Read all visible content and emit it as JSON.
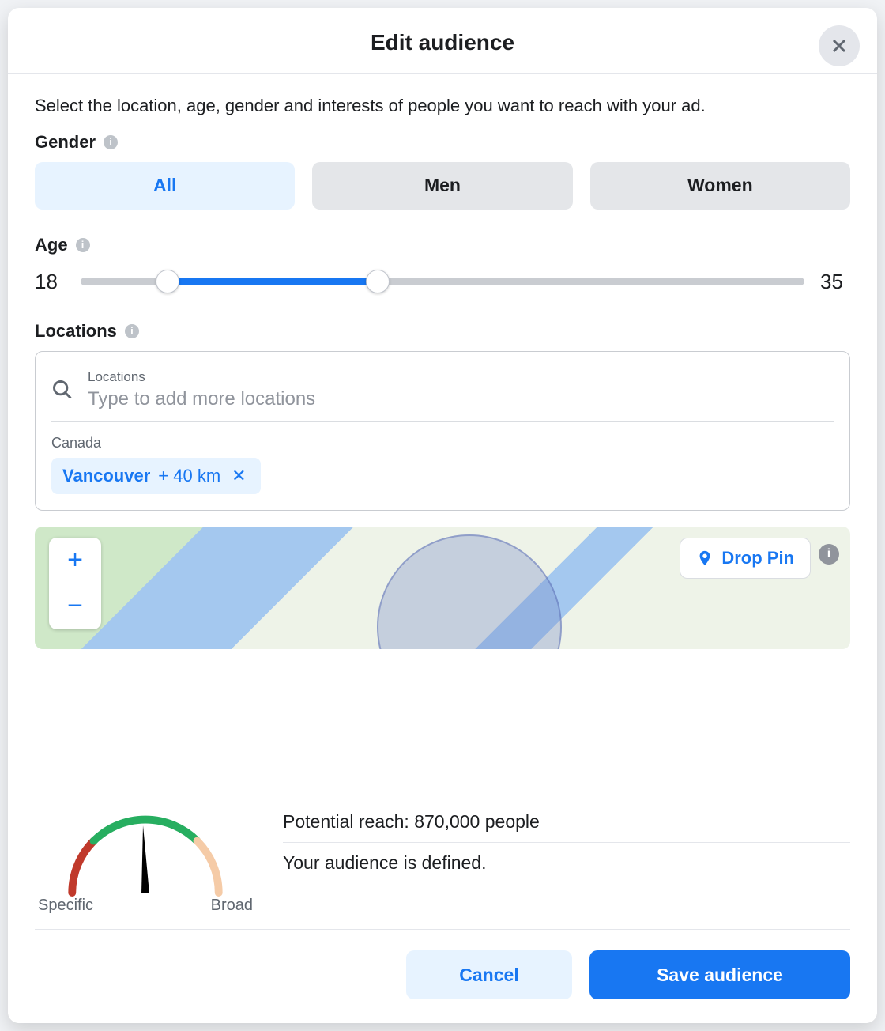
{
  "header": {
    "title": "Edit audience"
  },
  "intro": "Select the location, age, gender and interests of people you want to reach with your ad.",
  "gender": {
    "label": "Gender",
    "options": {
      "all": "All",
      "men": "Men",
      "women": "Women"
    },
    "selected": "all"
  },
  "age": {
    "label": "Age",
    "min_display": "18",
    "max_display": "35"
  },
  "locations": {
    "label": "Locations",
    "field_label": "Locations",
    "placeholder": "Type to add more locations",
    "country": "Canada",
    "chip_city": "Vancouver",
    "chip_radius": "+ 40 km"
  },
  "map": {
    "drop_pin": "Drop Pin"
  },
  "gauge": {
    "left": "Specific",
    "right": "Broad"
  },
  "reach": {
    "line1": "Potential reach: 870,000 people",
    "line2": "Your audience is defined."
  },
  "buttons": {
    "cancel": "Cancel",
    "save": "Save audience"
  }
}
